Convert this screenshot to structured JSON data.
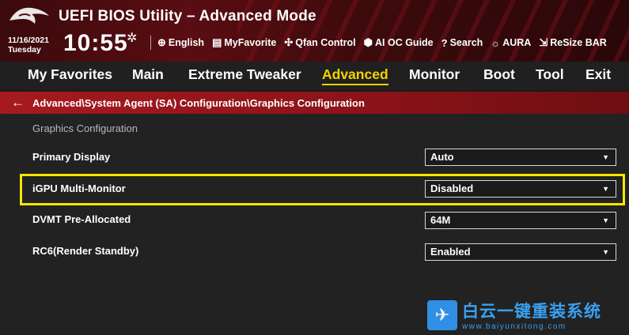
{
  "header": {
    "title": "UEFI BIOS Utility – Advanced Mode",
    "date": "11/16/2021",
    "day": "Tuesday",
    "time": "10:55",
    "utilities": [
      {
        "icon": "globe-icon",
        "glyph": "⊕",
        "label": "English"
      },
      {
        "icon": "favorite-icon",
        "glyph": "▤",
        "label": "MyFavorite"
      },
      {
        "icon": "fan-icon",
        "glyph": "✣",
        "label": "Qfan Control"
      },
      {
        "icon": "ai-oc-icon",
        "glyph": "⬢",
        "label": "AI OC Guide"
      },
      {
        "icon": "search-icon",
        "glyph": "?",
        "label": "Search"
      },
      {
        "icon": "aura-icon",
        "glyph": "☼",
        "label": "AURA"
      },
      {
        "icon": "resize-bar-icon",
        "glyph": "⇲",
        "label": "ReSize BAR"
      }
    ]
  },
  "menu": {
    "items": [
      "My Favorites",
      "Main",
      "Extreme Tweaker",
      "Advanced",
      "Monitor",
      "Boot",
      "Tool",
      "Exit"
    ],
    "active": "Advanced"
  },
  "breadcrumb": {
    "path": "Advanced\\System Agent (SA) Configuration\\Graphics Configuration"
  },
  "content": {
    "section_title": "Graphics Configuration",
    "settings": [
      {
        "label": "Primary Display",
        "value": "Auto"
      },
      {
        "label": "iGPU Multi-Monitor",
        "value": "Disabled"
      },
      {
        "label": "DVMT Pre-Allocated",
        "value": "64M"
      },
      {
        "label": "RC6(Render Standby)",
        "value": "Enabled"
      }
    ],
    "highlighted": "iGPU Multi-Monitor"
  },
  "watermark": {
    "title": "白云一键重装系统",
    "url": "www.baiyunxitong.com"
  },
  "colors": {
    "accent_yellow": "#f5d200",
    "header_red": "#5a0d12",
    "breadcrumb_red": "#a61a1f",
    "watermark_blue": "#2f8fe5"
  }
}
